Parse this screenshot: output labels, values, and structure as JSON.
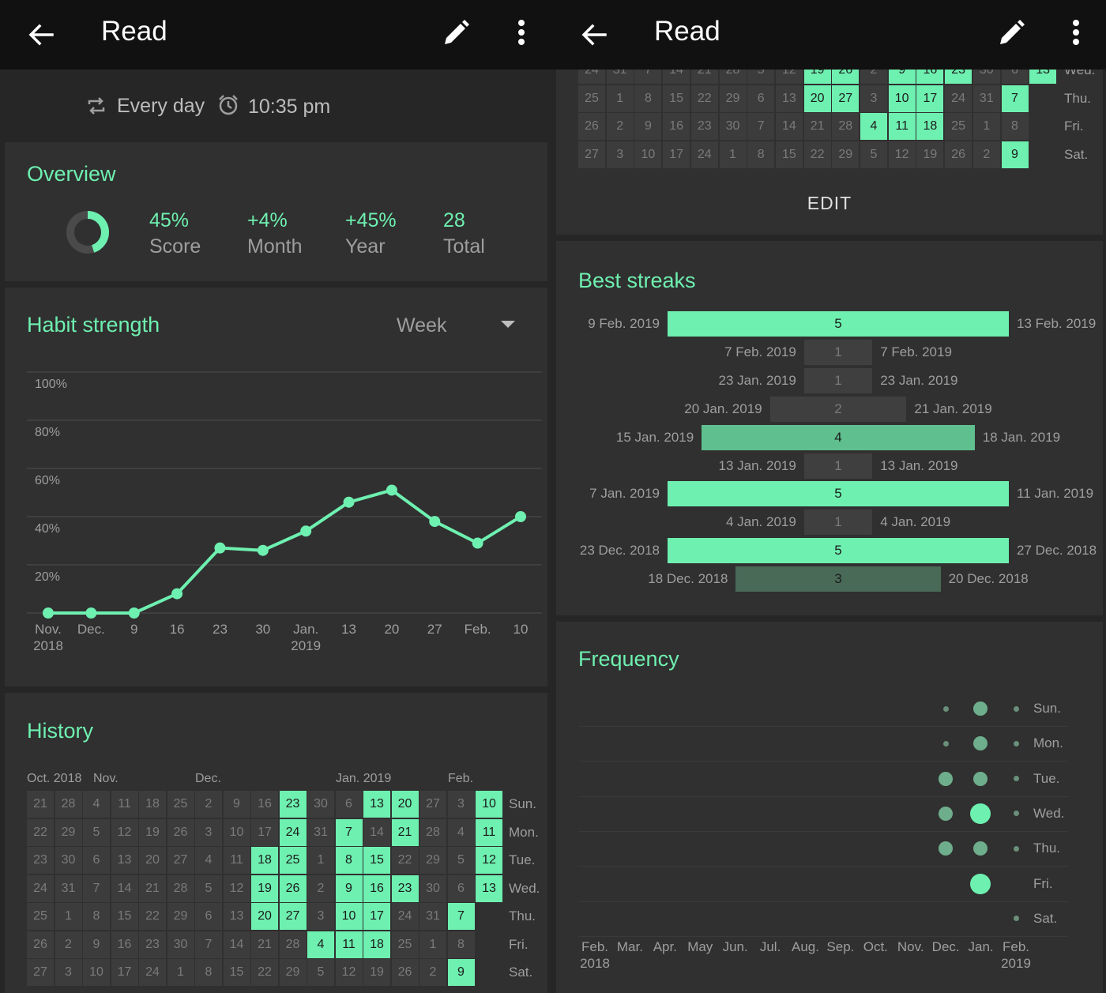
{
  "colors": {
    "accent": "#6ef0b0",
    "card": "#303030",
    "bg": "#262626",
    "appbar": "#111111",
    "cell_off": "#3c3c3c"
  },
  "left": {
    "appbar": {
      "title": "Read",
      "back_icon": "arrow-left-icon",
      "edit_icon": "pencil-icon",
      "more_icon": "more-vert-icon"
    },
    "schedule": {
      "frequency": "Every day",
      "reminder": "10:35 pm"
    },
    "overview": {
      "title": "Overview",
      "score_fraction": 0.45,
      "stats": [
        {
          "value": "45%",
          "label": "Score"
        },
        {
          "value": "+4%",
          "label": "Month"
        },
        {
          "value": "+45%",
          "label": "Year"
        },
        {
          "value": "28",
          "label": "Total"
        }
      ]
    },
    "strength": {
      "title": "Habit strength",
      "period": "Week",
      "y_ticks": [
        "100%",
        "80%",
        "60%",
        "40%",
        "20%"
      ],
      "x_labels": [
        {
          "top": "Nov.",
          "bottom": "2018"
        },
        {
          "top": "Dec.",
          "bottom": ""
        },
        {
          "top": "9",
          "bottom": ""
        },
        {
          "top": "16",
          "bottom": ""
        },
        {
          "top": "23",
          "bottom": ""
        },
        {
          "top": "30",
          "bottom": ""
        },
        {
          "top": "Jan.",
          "bottom": "2019"
        },
        {
          "top": "13",
          "bottom": ""
        },
        {
          "top": "20",
          "bottom": ""
        },
        {
          "top": "27",
          "bottom": ""
        },
        {
          "top": "Feb.",
          "bottom": ""
        },
        {
          "top": "10",
          "bottom": ""
        }
      ]
    },
    "history": {
      "title": "History",
      "month_labels": [
        "Oct. 2018",
        "Nov.",
        "Dec.",
        "Jan. 2019",
        "Feb."
      ],
      "day_labels": [
        "Sun.",
        "Mon.",
        "Tue.",
        "Wed.",
        "Thu.",
        "Fri.",
        "Sat."
      ]
    }
  },
  "right": {
    "appbar": {
      "title": "Read",
      "back_icon": "arrow-left-icon",
      "edit_icon": "pencil-icon",
      "more_icon": "more-vert-icon"
    },
    "history_tail": {
      "day_labels": [
        "Wed.",
        "Thu.",
        "Fri.",
        "Sat."
      ],
      "edit_label": "EDIT"
    },
    "streaks": {
      "title": "Best streaks",
      "items": [
        {
          "start": "9 Feb. 2019",
          "end": "13 Feb. 2019",
          "length": "5"
        },
        {
          "start": "7 Feb. 2019",
          "end": "7 Feb. 2019",
          "length": "1"
        },
        {
          "start": "23 Jan. 2019",
          "end": "23 Jan. 2019",
          "length": "1"
        },
        {
          "start": "20 Jan. 2019",
          "end": "21 Jan. 2019",
          "length": "2"
        },
        {
          "start": "15 Jan. 2019",
          "end": "18 Jan. 2019",
          "length": "4"
        },
        {
          "start": "13 Jan. 2019",
          "end": "13 Jan. 2019",
          "length": "1"
        },
        {
          "start": "7 Jan. 2019",
          "end": "11 Jan. 2019",
          "length": "5"
        },
        {
          "start": "4 Jan. 2019",
          "end": "4 Jan. 2019",
          "length": "1"
        },
        {
          "start": "23 Dec. 2018",
          "end": "27 Dec. 2018",
          "length": "5"
        },
        {
          "start": "18 Dec. 2018",
          "end": "20 Dec. 2018",
          "length": "3"
        }
      ]
    },
    "frequency": {
      "title": "Frequency",
      "day_labels": [
        "Sun.",
        "Mon.",
        "Tue.",
        "Wed.",
        "Thu.",
        "Fri.",
        "Sat."
      ],
      "x_labels": [
        {
          "top": "Feb.",
          "bottom": "2018"
        },
        {
          "top": "Mar.",
          "bottom": ""
        },
        {
          "top": "Apr.",
          "bottom": ""
        },
        {
          "top": "May",
          "bottom": ""
        },
        {
          "top": "Jun.",
          "bottom": ""
        },
        {
          "top": "Jul.",
          "bottom": ""
        },
        {
          "top": "Aug.",
          "bottom": ""
        },
        {
          "top": "Sep.",
          "bottom": ""
        },
        {
          "top": "Oct.",
          "bottom": ""
        },
        {
          "top": "Nov.",
          "bottom": ""
        },
        {
          "top": "Dec.",
          "bottom": ""
        },
        {
          "top": "Jan.",
          "bottom": ""
        },
        {
          "top": "Feb.",
          "bottom": "2019"
        }
      ]
    }
  },
  "chart_data": [
    {
      "type": "line",
      "title": "Habit strength",
      "x": [
        "Nov. 2018",
        "Dec.",
        "9",
        "16",
        "23",
        "30",
        "Jan. 2019",
        "13",
        "20",
        "27",
        "Feb.",
        "10"
      ],
      "series": [
        {
          "values": [
            0,
            0,
            0,
            8,
            27,
            26,
            34,
            46,
            51,
            38,
            29,
            40
          ]
        }
      ],
      "ylim": [
        0,
        100
      ],
      "y_unit": "%",
      "grid": true
    },
    {
      "type": "heatmap",
      "title": "History",
      "rows": [
        "Sun.",
        "Mon.",
        "Tue.",
        "Wed.",
        "Thu.",
        "Fri.",
        "Sat."
      ],
      "weeks": [
        {
          "days": [
            "21",
            "22",
            "23",
            "24",
            "25",
            "26",
            "27"
          ],
          "done": [
            0,
            0,
            0,
            0,
            0,
            0,
            0
          ]
        },
        {
          "days": [
            "28",
            "29",
            "30",
            "31",
            "1",
            "2",
            "3"
          ],
          "done": [
            0,
            0,
            0,
            0,
            0,
            0,
            0
          ]
        },
        {
          "days": [
            "4",
            "5",
            "6",
            "7",
            "8",
            "9",
            "10"
          ],
          "done": [
            0,
            0,
            0,
            0,
            0,
            0,
            0
          ]
        },
        {
          "days": [
            "11",
            "12",
            "13",
            "14",
            "15",
            "16",
            "17"
          ],
          "done": [
            0,
            0,
            0,
            0,
            0,
            0,
            0
          ]
        },
        {
          "days": [
            "18",
            "19",
            "20",
            "21",
            "22",
            "23",
            "24"
          ],
          "done": [
            0,
            0,
            0,
            0,
            0,
            0,
            0
          ]
        },
        {
          "days": [
            "25",
            "26",
            "27",
            "28",
            "29",
            "30",
            "1"
          ],
          "done": [
            0,
            0,
            0,
            0,
            0,
            0,
            0
          ]
        },
        {
          "days": [
            "2",
            "3",
            "4",
            "5",
            "6",
            "7",
            "8"
          ],
          "done": [
            0,
            0,
            0,
            0,
            0,
            0,
            0
          ]
        },
        {
          "days": [
            "9",
            "10",
            "11",
            "12",
            "13",
            "14",
            "15"
          ],
          "done": [
            0,
            0,
            0,
            0,
            0,
            0,
            0
          ]
        },
        {
          "days": [
            "16",
            "17",
            "18",
            "19",
            "20",
            "21",
            "22"
          ],
          "done": [
            0,
            0,
            1,
            1,
            1,
            0,
            0
          ]
        },
        {
          "days": [
            "23",
            "24",
            "25",
            "26",
            "27",
            "28",
            "29"
          ],
          "done": [
            1,
            1,
            1,
            1,
            1,
            0,
            0
          ]
        },
        {
          "days": [
            "30",
            "31",
            "1",
            "2",
            "3",
            "4",
            "5"
          ],
          "done": [
            0,
            0,
            0,
            0,
            0,
            1,
            0
          ]
        },
        {
          "days": [
            "6",
            "7",
            "8",
            "9",
            "10",
            "11",
            "12"
          ],
          "done": [
            0,
            1,
            1,
            1,
            1,
            1,
            0
          ]
        },
        {
          "days": [
            "13",
            "14",
            "15",
            "16",
            "17",
            "18",
            "19"
          ],
          "done": [
            1,
            0,
            1,
            1,
            1,
            1,
            0
          ]
        },
        {
          "days": [
            "20",
            "21",
            "22",
            "23",
            "24",
            "25",
            "26"
          ],
          "done": [
            1,
            1,
            0,
            1,
            0,
            0,
            0
          ]
        },
        {
          "days": [
            "27",
            "28",
            "29",
            "30",
            "31",
            "1",
            "2"
          ],
          "done": [
            0,
            0,
            0,
            0,
            0,
            0,
            0
          ]
        },
        {
          "days": [
            "3",
            "4",
            "5",
            "6",
            "7",
            "8",
            "9"
          ],
          "done": [
            0,
            0,
            0,
            0,
            1,
            0,
            1
          ]
        },
        {
          "days": [
            "10",
            "11",
            "12",
            "13",
            "",
            "",
            ""
          ],
          "done": [
            1,
            1,
            1,
            1,
            0,
            0,
            0
          ]
        }
      ]
    },
    {
      "type": "bar",
      "title": "Best streaks",
      "categories": [
        "9 Feb. 2019",
        "7 Feb. 2019",
        "23 Jan. 2019",
        "20 Jan. 2019",
        "15 Jan. 2019",
        "13 Jan. 2019",
        "7 Jan. 2019",
        "4 Jan. 2019",
        "23 Dec. 2018",
        "18 Dec. 2018"
      ],
      "values": [
        5,
        1,
        1,
        2,
        4,
        1,
        5,
        1,
        5,
        3
      ]
    },
    {
      "type": "scatter",
      "title": "Frequency",
      "rows": [
        "Sun.",
        "Mon.",
        "Tue.",
        "Wed.",
        "Thu.",
        "Fri.",
        "Sat."
      ],
      "columns": [
        "Dec.",
        "Jan.",
        "Feb."
      ],
      "values": [
        [
          1,
          4,
          1
        ],
        [
          1,
          4,
          1
        ],
        [
          4,
          4,
          1
        ],
        [
          4,
          8,
          1
        ],
        [
          4,
          4,
          1
        ],
        [
          0,
          8,
          0
        ],
        [
          0,
          0,
          1
        ]
      ]
    }
  ]
}
